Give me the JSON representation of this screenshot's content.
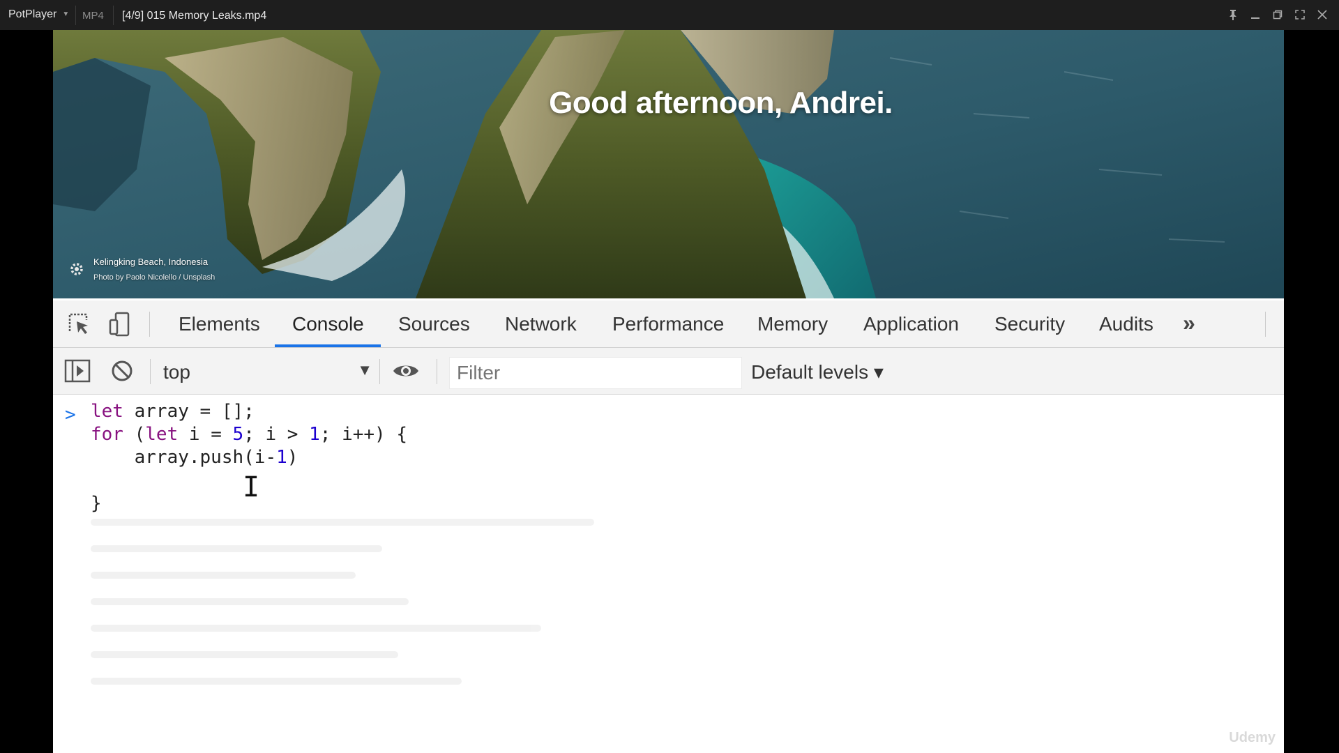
{
  "player": {
    "app_name": "PotPlayer",
    "format": "MP4",
    "file_title": "[4/9] 015 Memory Leaks.mp4"
  },
  "hero": {
    "greeting": "Good afternoon, Andrei.",
    "location": "Kelingking Beach, Indonesia",
    "photo_credit": "Photo by Paolo Nicolello / Unsplash"
  },
  "devtools": {
    "tabs": [
      "Elements",
      "Console",
      "Sources",
      "Network",
      "Performance",
      "Memory",
      "Application",
      "Security",
      "Audits"
    ],
    "active_tab": "Console",
    "context": "top",
    "filter_placeholder": "Filter",
    "levels": "Default levels ▾"
  },
  "console": {
    "code": {
      "l1_kw": "let",
      "l1_rest": " array = [];",
      "l2_kw1": "for",
      "l2_p1": " (",
      "l2_kw2": "let",
      "l2_p2": " i = ",
      "l2_n1": "5",
      "l2_p3": "; i > ",
      "l2_n2": "1",
      "l2_p4": "; i++) {",
      "l3_p1": "    array.push(i-",
      "l3_n1": "1",
      "l3_p2": ")",
      "l5": "}"
    }
  },
  "watermark": "Udemy"
}
